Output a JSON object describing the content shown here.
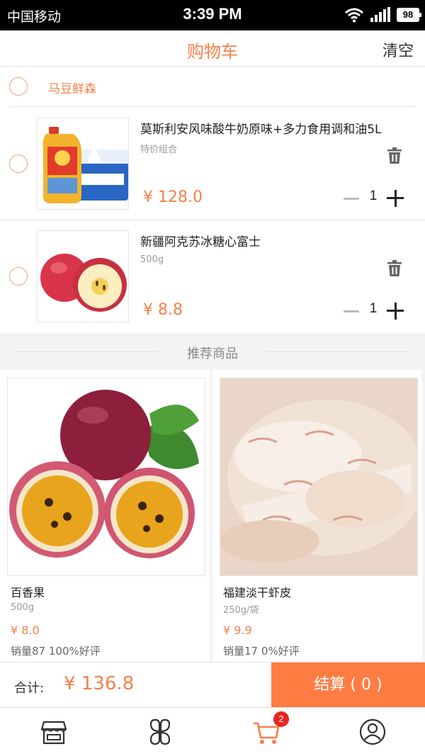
{
  "status_bar": {
    "carrier": "中国移动",
    "time": "3:39 PM",
    "battery": "98"
  },
  "header": {
    "title": "购物车",
    "clear_label": "清空"
  },
  "shop": {
    "name": "马豆鲜森"
  },
  "cart_items": [
    {
      "name": "莫斯利安风味酸牛奶原味+多力食用调和油5L",
      "spec": "特价组合",
      "price": "¥ 128.0",
      "quantity": "1",
      "image": "yogurt-and-cooking-oil-bundle"
    },
    {
      "name": "新疆阿克苏冰糖心富士",
      "spec": "500g",
      "price": "¥ 8.8",
      "quantity": "1",
      "image": "fuji-apples"
    }
  ],
  "recommend": {
    "title": "推荐商品",
    "items": [
      {
        "name": "百香果",
        "spec": "500g",
        "price": "¥ 8.0",
        "sales": "销量87  100%好评",
        "image": "passion-fruit"
      },
      {
        "name": "福建淡干虾皮",
        "spec": "250g/袋",
        "price": "¥ 9.9",
        "sales": "销量17  0%好评",
        "image": "dried-shrimp"
      }
    ]
  },
  "total": {
    "label": "合计:",
    "amount": "¥ 136.8",
    "checkout_label": "结算 ( 0 )"
  },
  "tab_bar": {
    "tabs": [
      {
        "icon": "store-icon",
        "active": false
      },
      {
        "icon": "category-icon",
        "active": false
      },
      {
        "icon": "cart-icon",
        "active": true,
        "badge": "2"
      },
      {
        "icon": "profile-icon",
        "active": false
      }
    ]
  },
  "colors": {
    "accent": "#f5804a",
    "checkout": "#ff7c43",
    "badge": "#e8261f"
  }
}
